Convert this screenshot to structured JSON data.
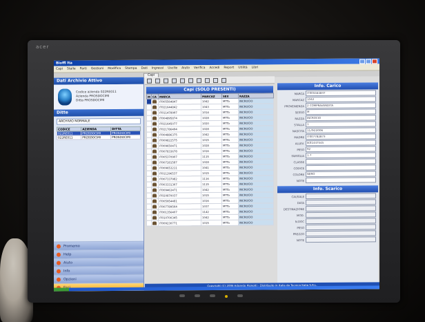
{
  "window": {
    "title": "Bioffl Ita"
  },
  "menu": [
    "Capi",
    "Stalle",
    "Parti",
    "Gestioni",
    "Modifica",
    "Stampa",
    "Dati",
    "Ingressi",
    "Uscite",
    "Aiuto",
    "Verifica",
    "Accedi",
    "Report",
    "Utilità",
    "Libri"
  ],
  "tab": "Capi",
  "left": {
    "header": "Dati Archivio Attivo",
    "archive_lines": [
      "Codice azienda 022RE011",
      "Azienda PROSDOCIMI",
      "Ditta PROSDOCIMI"
    ],
    "ditte_header": "Ditte",
    "select_value": "ARCHIVIO NORMALE",
    "ditte_columns": [
      "CODICE",
      "AZIENDA",
      "DITTA"
    ],
    "ditte_rows": [
      [
        "022RE011",
        "PROSDOCIMI",
        "PROSDOCIMI"
      ],
      [
        "022RE011",
        "PROSDOCIMI",
        "PROSDOCIMI"
      ]
    ],
    "nav": [
      "Promemo",
      "Help",
      "Aiuto",
      "Info",
      "Opzioni",
      "Esci"
    ]
  },
  "center": {
    "header": "Capi (SOLO PRESENTI)",
    "columns": [
      "M",
      "CA",
      "MARCA",
      "MARCAZ",
      "SEX",
      "RAZZA"
    ],
    "rows": [
      [
        "IT005564847",
        "1042",
        "MTTa",
        "INCROCIO"
      ],
      [
        "IT021644842",
        "1043",
        "MTTa",
        "INCROCIO"
      ],
      [
        "IT011478997",
        "1014",
        "MTTa",
        "INCROCIO"
      ],
      [
        "IT004895874",
        "1028",
        "MTTa",
        "INCROCIO"
      ],
      [
        "IT021645077",
        "1020",
        "MTTa",
        "INCROCIO"
      ],
      [
        "IT021786494",
        "1028",
        "MTTa",
        "INCROCIO"
      ],
      [
        "IT004886375",
        "1042",
        "MTTa",
        "INCROCIO"
      ],
      [
        "IT009822575",
        "1015",
        "MTTa",
        "INCROCIO"
      ],
      [
        "IT009650471",
        "1028",
        "MTTa",
        "INCROCIO"
      ],
      [
        "IT007833678",
        "1016",
        "MTTa",
        "INCROCIO"
      ],
      [
        "IT005370907",
        "1115",
        "MTTa",
        "INCROCIO"
      ],
      [
        "IT007281587",
        "1028",
        "MTTa",
        "INCROCIO"
      ],
      [
        "IT009653211",
        "1041",
        "MTTa",
        "INCROCIO"
      ],
      [
        "IT011296537",
        "1015",
        "MTTa",
        "INCROCIO"
      ],
      [
        "IT007337982",
        "1116",
        "MTTa",
        "INCROCIO"
      ],
      [
        "IT003331367",
        "1115",
        "MTTa",
        "INCROCIO"
      ],
      [
        "IT009463471",
        "1042",
        "MTTa",
        "INCROCIO"
      ],
      [
        "IT020870037",
        "1015",
        "MTTa",
        "INCROCIO"
      ],
      [
        "IT005954481",
        "1016",
        "MTTa",
        "INCROCIO"
      ],
      [
        "IT007789564",
        "1037",
        "MTTa",
        "INCROCIO"
      ],
      [
        "IT001356407",
        "1142",
        "MTTa",
        "INCROCIO"
      ],
      [
        "IT010700345",
        "1042",
        "MTTa",
        "INCROCIO"
      ],
      [
        "IT009230771",
        "1015",
        "MTTa",
        "INCROCIO"
      ]
    ]
  },
  "right": {
    "carico_header": "Info. Carico",
    "carico_fields": [
      [
        "MARCA",
        "IT005564847"
      ],
      [
        "MARCAZ",
        "1042"
      ],
      [
        "PROVENIENZA",
        "2 COMPRAVENDITA"
      ],
      [
        "SESSO",
        "M"
      ],
      [
        "RAZZA",
        "INCROCIO"
      ],
      [
        "STALLA",
        "1"
      ],
      [
        "NASCITA",
        "11/04/2006"
      ],
      [
        "MADRE",
        "IT007782873"
      ],
      [
        "ALLEV.",
        "IK01447545"
      ],
      [
        "PESO",
        "92"
      ],
      [
        "FAMIGLIA",
        "1.7"
      ],
      [
        "CLASSE",
        ""
      ],
      [
        "CODICE",
        ""
      ],
      [
        "COLORE",
        "NERO"
      ],
      [
        "NOTE",
        ""
      ]
    ],
    "scarico_header": "Info. Scarico",
    "scarico_fields": [
      [
        "CAUSALE",
        ""
      ],
      [
        "DATA",
        ""
      ],
      [
        "DESTINAZIONE",
        ""
      ],
      [
        "MOD.",
        ""
      ],
      [
        "N.DOC",
        ""
      ],
      [
        "PESO",
        ""
      ],
      [
        "PREZZO",
        ""
      ],
      [
        "NOTE",
        ""
      ]
    ]
  },
  "footer": "Copyright (C) 2006 Edoardo Pignotti - Distribuito in Italia da Tecnica Italia S.R.L."
}
